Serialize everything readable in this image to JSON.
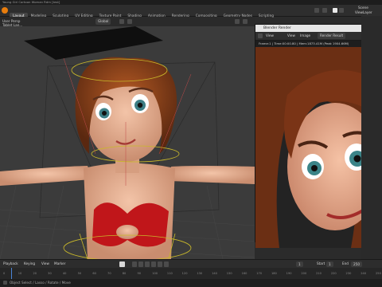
{
  "title_bar": {
    "text": "Young Girl Cartoon Woman Rdm [test]"
  },
  "workspaces": {
    "active": "Layout",
    "tabs": [
      "Layout",
      "Modeling",
      "Sculpting",
      "UV Editing",
      "Texture Paint",
      "Shading",
      "Animation",
      "Rendering",
      "Compositing",
      "Geometry Nodes",
      "Scripting"
    ]
  },
  "top_right": {
    "scene_label": "Scene",
    "view_layer_label": "ViewLayer"
  },
  "viewport_header": {
    "view_label": "User Persp",
    "object_label": "Tablet Lan...",
    "mode_label": "Global"
  },
  "render_window": {
    "title": "Blender Render",
    "menu": [
      "View",
      "View",
      "Image"
    ],
    "slot_label": "Render Result",
    "info": "Frame:1 | Time:00:00.80 | Mem:1873.41M (Peak 1904.66M)"
  },
  "timeline": {
    "menu": [
      "Playback",
      "Keying",
      "View",
      "Marker"
    ],
    "start_label": "Start",
    "start_value": "1",
    "end_label": "End",
    "end_value": "250",
    "current_frame": "1",
    "ticks": [
      "0",
      "10",
      "20",
      "30",
      "40",
      "50",
      "60",
      "70",
      "80",
      "90",
      "100",
      "110",
      "120",
      "130",
      "140",
      "150",
      "160",
      "170",
      "180",
      "190",
      "200",
      "210",
      "220",
      "230",
      "240",
      "250"
    ]
  },
  "status_bar": {
    "text": "Object Select / Lasso / Rotate / Move"
  },
  "colors": {
    "accent": "#e87d0d",
    "bikini": "#c0161a",
    "hair": "#8a3f1a"
  }
}
